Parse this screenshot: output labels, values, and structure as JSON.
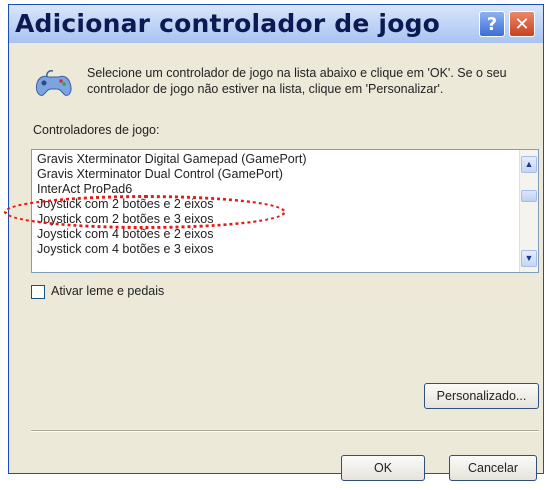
{
  "window": {
    "title": "Adicionar controlador de jogo",
    "help_label": "?",
    "close_label": "✕"
  },
  "description": "Selecione um controlador de jogo na lista abaixo e clique em 'OK'. Se o seu controlador de jogo não estiver na lista, clique em 'Personalizar'.",
  "list": {
    "label": "Controladores de jogo:",
    "items": [
      "Gravis Xterminator Digital Gamepad (GamePort)",
      "Gravis Xterminator Dual Control (GamePort)",
      "InterAct ProPad6",
      "Joystick com 2 botões e 2 eixos",
      "Joystick com 2 botões e 3 eixos",
      "Joystick com 4 botões e 2 eixos",
      "Joystick com 4 botões e 3 eixos"
    ],
    "highlighted_item": "Joystick com 2 botões e 2 eixos"
  },
  "checkbox": {
    "label": "Ativar leme e pedais",
    "checked": false
  },
  "buttons": {
    "custom": "Personalizado...",
    "ok": "OK",
    "cancel": "Cancelar"
  },
  "colors": {
    "highlight_circle": "#e81818",
    "title_text": "#0b1a52"
  }
}
